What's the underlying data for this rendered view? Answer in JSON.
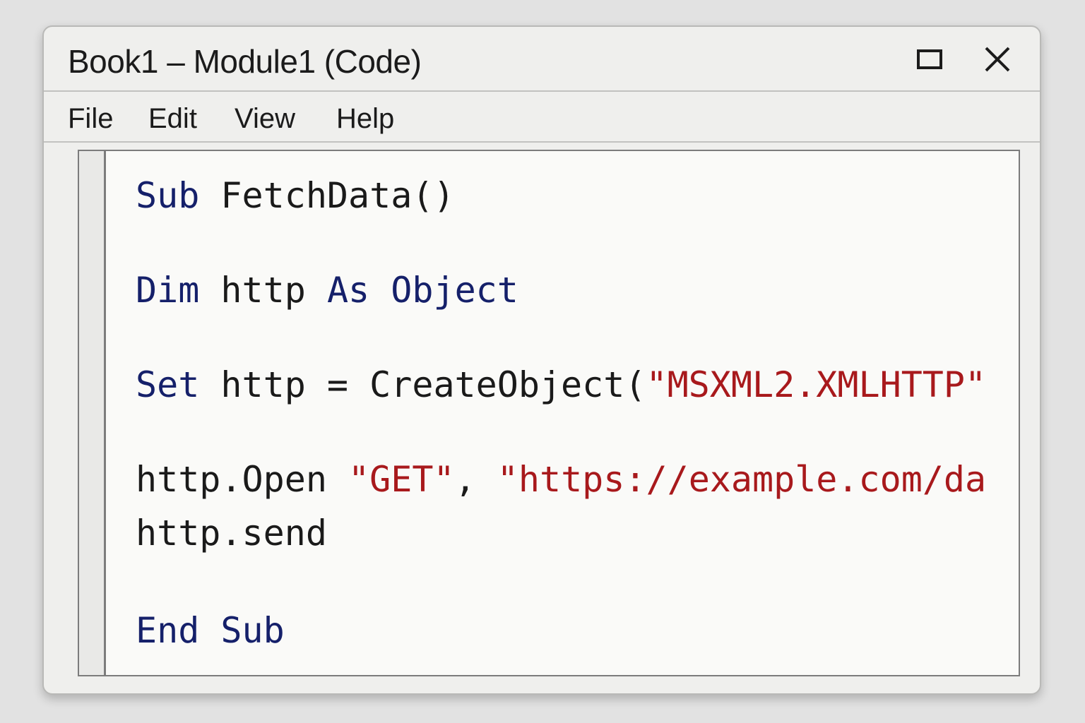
{
  "window": {
    "title": "Book1 – Module1 (Code)",
    "controls": {
      "maximize_icon": "maximize-icon",
      "close_icon": "close-icon"
    }
  },
  "menu": {
    "items": [
      "File",
      "Edit",
      "View",
      "Help"
    ]
  },
  "colors": {
    "keyword": "#15206a",
    "string": "#a8191c",
    "text": "#1a1a1a",
    "editor_background": "#fafaf8",
    "window_background": "#efefed"
  },
  "code": {
    "lines": [
      [
        {
          "t": "Sub",
          "k": "kw"
        },
        {
          "t": " FetchData()",
          "k": "plain"
        }
      ],
      [
        {
          "t": "Dim",
          "k": "kw"
        },
        {
          "t": " http ",
          "k": "plain"
        },
        {
          "t": "As",
          "k": "kw"
        },
        {
          "t": " ",
          "k": "plain"
        },
        {
          "t": "Object",
          "k": "kw"
        }
      ],
      [
        {
          "t": "Set",
          "k": "kw"
        },
        {
          "t": " http = CreateObject(",
          "k": "plain"
        },
        {
          "t": "\"MSXML2.XMLHTTP\"",
          "k": "str"
        }
      ],
      [
        {
          "t": "http.Open ",
          "k": "plain"
        },
        {
          "t": "\"GET\"",
          "k": "str"
        },
        {
          "t": ", ",
          "k": "plain"
        },
        {
          "t": "\"https://example.com/da",
          "k": "str"
        }
      ],
      [
        {
          "t": "http.send",
          "k": "plain"
        }
      ],
      [
        {
          "t": "End",
          "k": "kw"
        },
        {
          "t": " ",
          "k": "plain"
        },
        {
          "t": "Sub",
          "k": "kw"
        }
      ]
    ]
  }
}
